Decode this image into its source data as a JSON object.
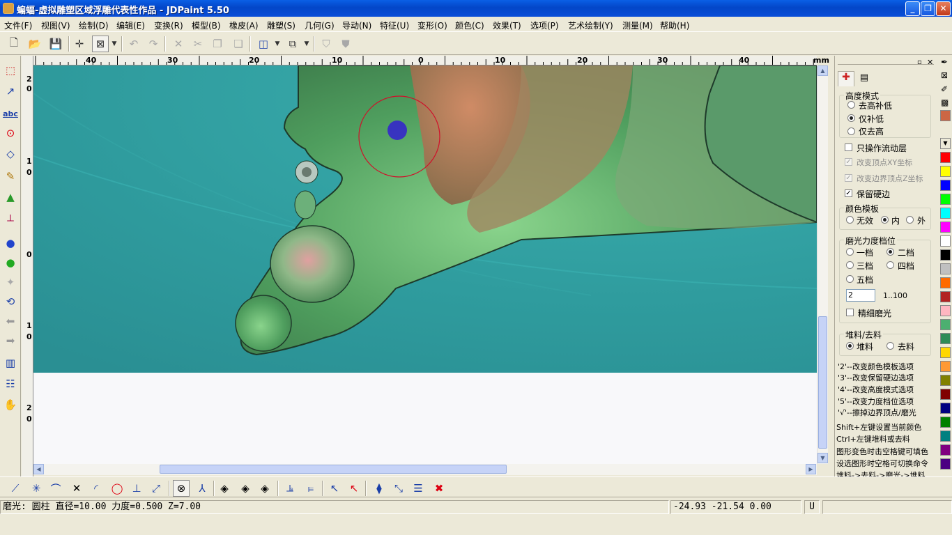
{
  "window": {
    "title": "蝙蝠-虚拟雕塑区域浮雕代表性作品 - JDPaint 5.50"
  },
  "menu": [
    "文件(F)",
    "视图(V)",
    "绘制(D)",
    "编辑(E)",
    "变换(R)",
    "模型(B)",
    "橡皮(A)",
    "雕塑(S)",
    "几何(G)",
    "导动(N)",
    "特征(U)",
    "变形(O)",
    "颜色(C)",
    "效果(T)",
    "选项(P)",
    "艺术绘制(Y)",
    "测量(M)",
    "帮助(H)"
  ],
  "ruler": {
    "unit": "mm",
    "top_labels": [
      "40",
      "30",
      "20",
      "10",
      "0",
      "10",
      "20",
      "30",
      "40"
    ],
    "left_labels": [
      "2",
      "0",
      "1",
      "0",
      "0",
      "1",
      "0",
      "2",
      "0"
    ]
  },
  "panel": {
    "height_mode": {
      "title": "高度模式",
      "options": [
        "去高补低",
        "仅补低",
        "仅去高"
      ],
      "selected": "仅补低"
    },
    "flow_only": {
      "label": "只操作流动层",
      "checked": false
    },
    "change_xy": {
      "label": "改变顶点XY坐标",
      "checked": true,
      "disabled": true
    },
    "change_z": {
      "label": "改变边界顶点Z坐标",
      "checked": true,
      "disabled": true
    },
    "keep_hard": {
      "label": "保留硬边",
      "checked": true
    },
    "color_template": {
      "title": "颜色模板",
      "options": [
        "无效",
        "内",
        "外"
      ],
      "selected": "内"
    },
    "polish_level": {
      "title": "磨光力度档位",
      "options": [
        "一档",
        "二档",
        "三档",
        "四档",
        "五档"
      ],
      "selected": "二档",
      "value": "2",
      "range": "1..100"
    },
    "fine_polish": {
      "label": "精细磨光",
      "checked": false
    },
    "material": {
      "title": "堆料/去料",
      "options": [
        "堆料",
        "去料"
      ],
      "selected": "堆料"
    },
    "hints": [
      "'2'--改变颜色模板选项",
      "'3'--改变保留硬边选项",
      "'4'--改变高度模式选项",
      "'5'--改变力度档位选项",
      "'√'--擦掉边界顶点/磨光"
    ],
    "tips": [
      "Shift+左键设置当前颜色",
      "Ctrl+左键堆料或去料",
      "图形变色时击空格键可填色",
      "设选图形时空格可切换命令",
      "堆料->去料->磨光->堆料"
    ]
  },
  "palette": [
    "#cc6644",
    "#c8c8c8",
    "#e8e8e8",
    "#ff0000",
    "#ffff00",
    "#0000ff",
    "#00ff00",
    "#00ffff",
    "#ff00ff",
    "#ffffff",
    "#000000",
    "#c0c0c0",
    "#ff6a00",
    "#b22222",
    "#ffb6c1",
    "#4caf70",
    "#2e8b57",
    "#ffd700",
    "#ff9933",
    "#808000",
    "#800000",
    "#000080",
    "#008000",
    "#008080",
    "#800080",
    "#4b0082"
  ],
  "status": {
    "mode": "磨光:  圆柱   直径=10.00   力度=0.500   Z=7.00",
    "coords": "-24.93 -21.54 0.00",
    "unit_btn": "U"
  }
}
